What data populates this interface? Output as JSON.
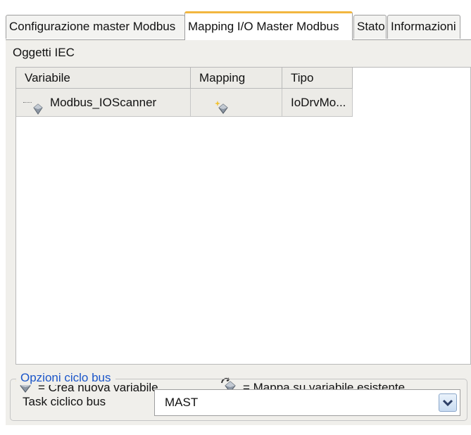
{
  "tabs": [
    {
      "label": "Configurazione master Modbus"
    },
    {
      "label": "Mapping I/O Master Modbus"
    },
    {
      "label": "Stato"
    },
    {
      "label": "Informazioni"
    }
  ],
  "iec": {
    "title": "Oggetti IEC",
    "columns": [
      "Variabile",
      "Mapping",
      "Tipo"
    ],
    "rows": [
      {
        "variable": "Modbus_IOScanner",
        "mapping_icon": "create-variable-icon",
        "type": "IoDrvMo..."
      }
    ]
  },
  "legend": {
    "create": "= Crea nuova variabile",
    "map": "= Mappa su variabile esistente"
  },
  "bus_options": {
    "title": "Opzioni ciclo bus",
    "task_label": "Task ciclico bus",
    "task_value": "MAST"
  },
  "colors": {
    "active_tab_accent": "#f2b63f",
    "group_title": "#1a55c9"
  }
}
